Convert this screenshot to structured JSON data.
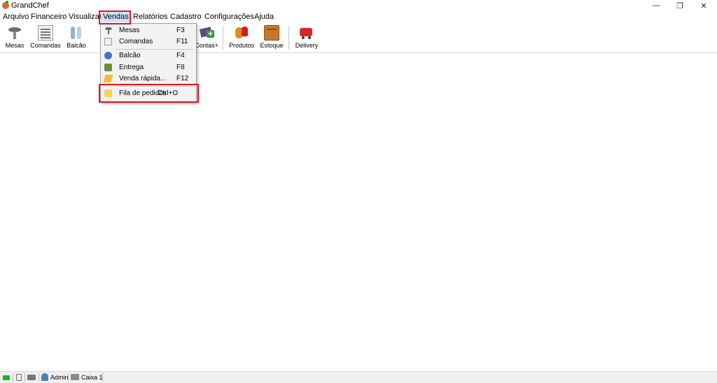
{
  "window": {
    "title": "GrandChef",
    "minimize_glyph": "—",
    "maximize_glyph": "❐",
    "close_glyph": "✕"
  },
  "menubar": {
    "items": [
      "Arquivo",
      "Financeiro",
      "Visualizar",
      "Vendas",
      "Relatórios",
      "Cadastro",
      "Configurações",
      "Ajuda"
    ],
    "active": "Vendas"
  },
  "toolbar": {
    "buttons": [
      {
        "label": "Mesas",
        "icon": "table-icon"
      },
      {
        "label": "Comandas",
        "icon": "order-slip-icon"
      },
      {
        "label": "Balcão",
        "icon": "counter-icon"
      },
      {
        "label": "Contas+",
        "icon": "accounts-plus-icon"
      },
      {
        "label": "Produtos",
        "icon": "products-icon"
      },
      {
        "label": "Estoque",
        "icon": "stock-box-icon"
      },
      {
        "label": "Delivery",
        "icon": "delivery-cart-icon"
      }
    ]
  },
  "vendas_menu": {
    "items": [
      {
        "label": "Mesas",
        "shortcut": "F3",
        "icon": "table-icon"
      },
      {
        "label": "Comandas",
        "shortcut": "F11",
        "icon": "order-slip-icon"
      },
      {
        "label": "Balcão",
        "shortcut": "F4",
        "icon": "counter-icon"
      },
      {
        "label": "Entrega",
        "shortcut": "F8",
        "icon": "truck-icon"
      },
      {
        "label": "Venda rápida...",
        "shortcut": "F12",
        "icon": "quick-sale-icon"
      },
      {
        "label": "Fila de pedidos",
        "shortcut": "Ctrl+O",
        "icon": "order-queue-icon"
      }
    ]
  },
  "statusbar": {
    "user": "Admin",
    "caixa": "Caixa 1"
  },
  "colors": {
    "highlight": "#e3141f",
    "active_menu": "#cce4f7"
  }
}
